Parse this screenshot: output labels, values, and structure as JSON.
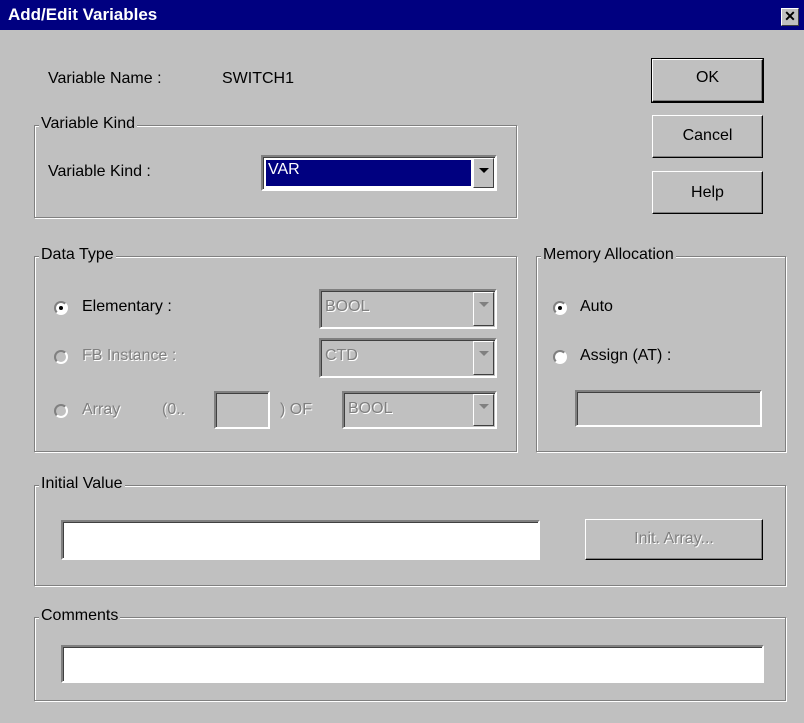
{
  "window": {
    "title": "Add/Edit Variables"
  },
  "variable_name": {
    "label": "Variable Name :",
    "value": "SWITCH1"
  },
  "buttons": {
    "ok": "OK",
    "cancel": "Cancel",
    "help": "Help",
    "init_array": "Init. Array..."
  },
  "variable_kind_group": {
    "title": "Variable Kind",
    "label": "Variable Kind :",
    "selected": "VAR"
  },
  "data_type_group": {
    "title": "Data Type",
    "elementary": {
      "label": "Elementary :",
      "value": "BOOL",
      "selected": true
    },
    "fb_instance": {
      "label": "FB Instance :",
      "value": "CTD",
      "selected": false
    },
    "array": {
      "label": "Array",
      "range_prefix": "(0..",
      "range_suffix": ") OF",
      "size_value": "",
      "type_value": "BOOL",
      "selected": false
    }
  },
  "memory_allocation_group": {
    "title": "Memory Allocation",
    "auto": {
      "label": "Auto",
      "selected": true
    },
    "assign": {
      "label": "Assign (AT) :",
      "selected": false,
      "value": ""
    }
  },
  "initial_value_group": {
    "title": "Initial Value",
    "value": ""
  },
  "comments_group": {
    "title": "Comments",
    "value": ""
  },
  "colors": {
    "titlebar": "#000080",
    "face": "#c0c0c0",
    "highlight": "#000080"
  },
  "icons": {
    "close": "close-icon",
    "dropdown": "chevron-down-icon"
  }
}
